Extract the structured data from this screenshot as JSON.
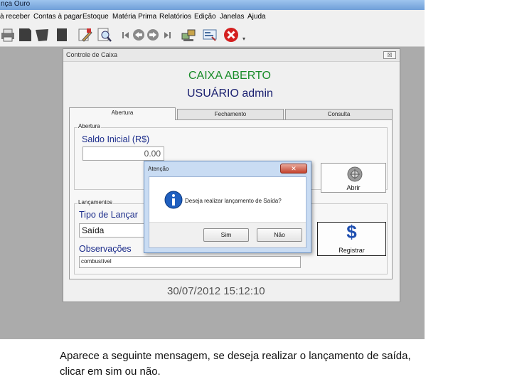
{
  "app": {
    "title": "nça Ouro"
  },
  "menu": [
    "à receber",
    "Contas à pagar",
    "Estoque",
    "Matéria Prima",
    "Relatórios",
    "Edição",
    "Janelas",
    "Ajuda"
  ],
  "toolbar": {
    "icons": [
      "printer-icon",
      "document-icon",
      "people-icon",
      "book-icon",
      "edit-pencil-icon",
      "search-document-icon",
      "nav-first-icon",
      "nav-prev-icon",
      "nav-next-icon",
      "nav-last-icon",
      "computers-icon",
      "form-icon",
      "close-red-icon"
    ],
    "overflow": "▾"
  },
  "window": {
    "title": "Controle de Caixa",
    "close": "☒",
    "status": "CAIXA ABERTO",
    "user": "USUÁRIO admin",
    "tabs": [
      "Abertura",
      "Fechamento",
      "Consulta"
    ],
    "abertura": {
      "group_label": "Abertura",
      "saldo_label": "Saldo Inicial (R$)",
      "saldo_value": "0.00",
      "abrir_label": "Abrir"
    },
    "lancamentos": {
      "group_label": "Lançamentos",
      "tipo_label": "Tipo de Lançar",
      "tipo_value": "Saída",
      "obs_label": "Observações",
      "obs_value": "combustível",
      "registrar_label": "Registrar"
    },
    "datetime": "30/07/2012 15:12:10"
  },
  "dialog": {
    "title": "Atenção",
    "close": "✕",
    "message": "Deseja realizar lançamento de Saída?",
    "yes": "Sim",
    "no": "Não"
  },
  "caption": "Aparece a seguinte mensagem, se deseja realizar o lançamento de saída, clicar em sim ou não.",
  "colors": {
    "status": "#1a8c2a",
    "user": "#1a2070",
    "labels": "#1a2b8a",
    "datetime": "#555555",
    "info_icon": "#1f5fbf",
    "close_icon": "#d42020",
    "dollar_icon": "#1f4fb0"
  }
}
